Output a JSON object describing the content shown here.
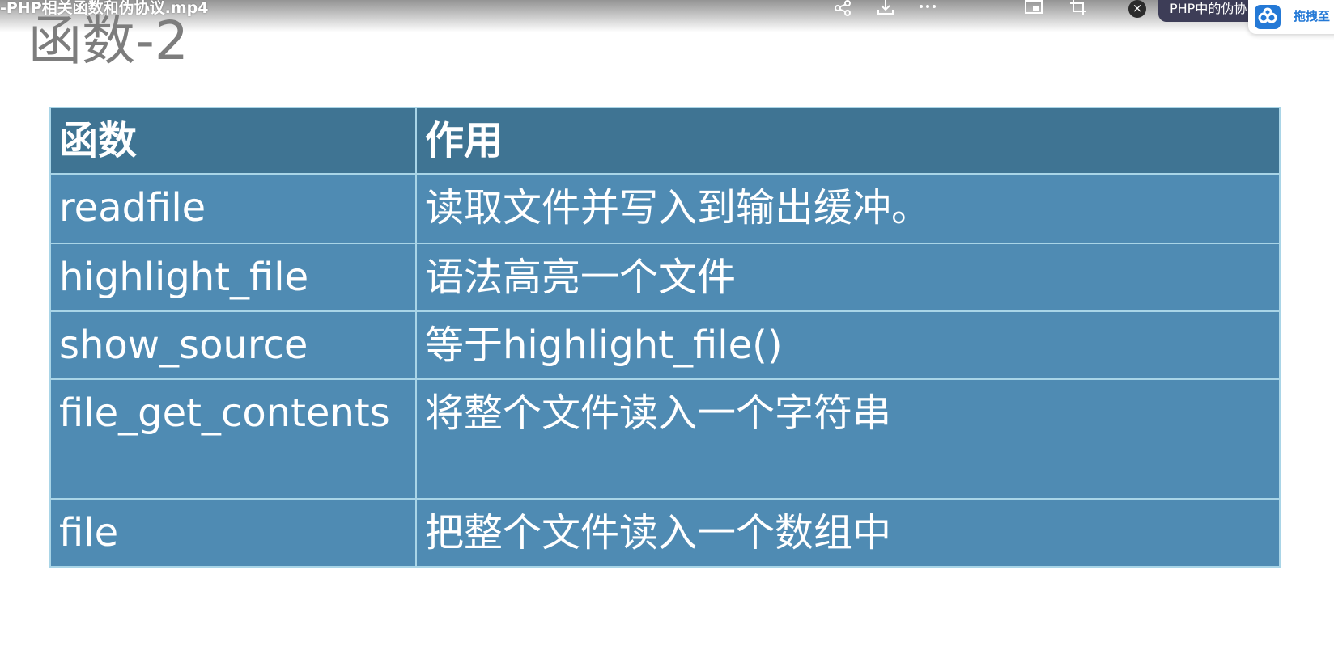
{
  "overlay": {
    "video_title": "-PHP相关函数和伪协议.mp4",
    "icons": [
      "share-icon",
      "download-icon",
      "more-icon",
      "picture-in-picture-icon",
      "screenshot-icon"
    ],
    "pill_text": "PHP中的伪协",
    "baidu_button_label": "拖拽至",
    "colors": {
      "pill_bg": "#3d3d57",
      "baidu_blue": "#2479d6"
    }
  },
  "slide": {
    "title": "函数-2",
    "table": {
      "headers": [
        "函数",
        "作用"
      ],
      "rows": [
        {
          "name": "readfile",
          "desc": "读取文件并写入到输出缓冲。"
        },
        {
          "name": "highlight_file",
          "desc": "语法高亮一个文件"
        },
        {
          "name": "show_source",
          "desc": "等于highlight_file()"
        },
        {
          "name": "file_get_contents",
          "desc": "将整个文件读入一个字符串"
        },
        {
          "name": "file",
          "desc": "把整个文件读入一个数组中"
        }
      ]
    },
    "colors": {
      "header_bg": "#3f7493",
      "row_bg": "#4f8bb3",
      "border": "#a9d5e7",
      "title": "#7d7d7d"
    }
  }
}
